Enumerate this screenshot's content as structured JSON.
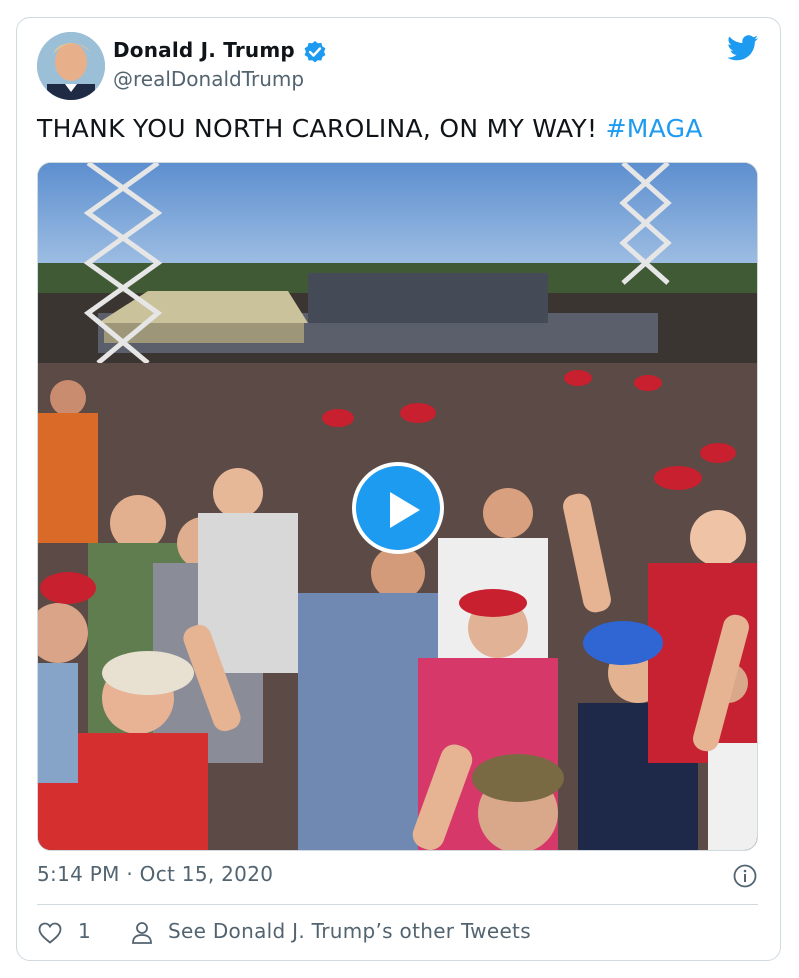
{
  "author": {
    "name": "Donald J. Trump",
    "handle": "@realDonaldTrump",
    "verified": true
  },
  "tweet": {
    "text": "THANK YOU NORTH CAROLINA, ON MY WAY! ",
    "hashtag": "#MAGA"
  },
  "media": {
    "type": "video",
    "play_icon": "play-icon"
  },
  "meta": {
    "timestamp": "5:14 PM · Oct 15, 2020",
    "info_icon": "info-icon"
  },
  "actions": {
    "like_count": "1",
    "see_others_label": "See Donald J. Trump’s other Tweets"
  },
  "colors": {
    "brand_blue": "#1d9bf0",
    "text_secondary": "#536471",
    "border": "#cfd9de"
  }
}
